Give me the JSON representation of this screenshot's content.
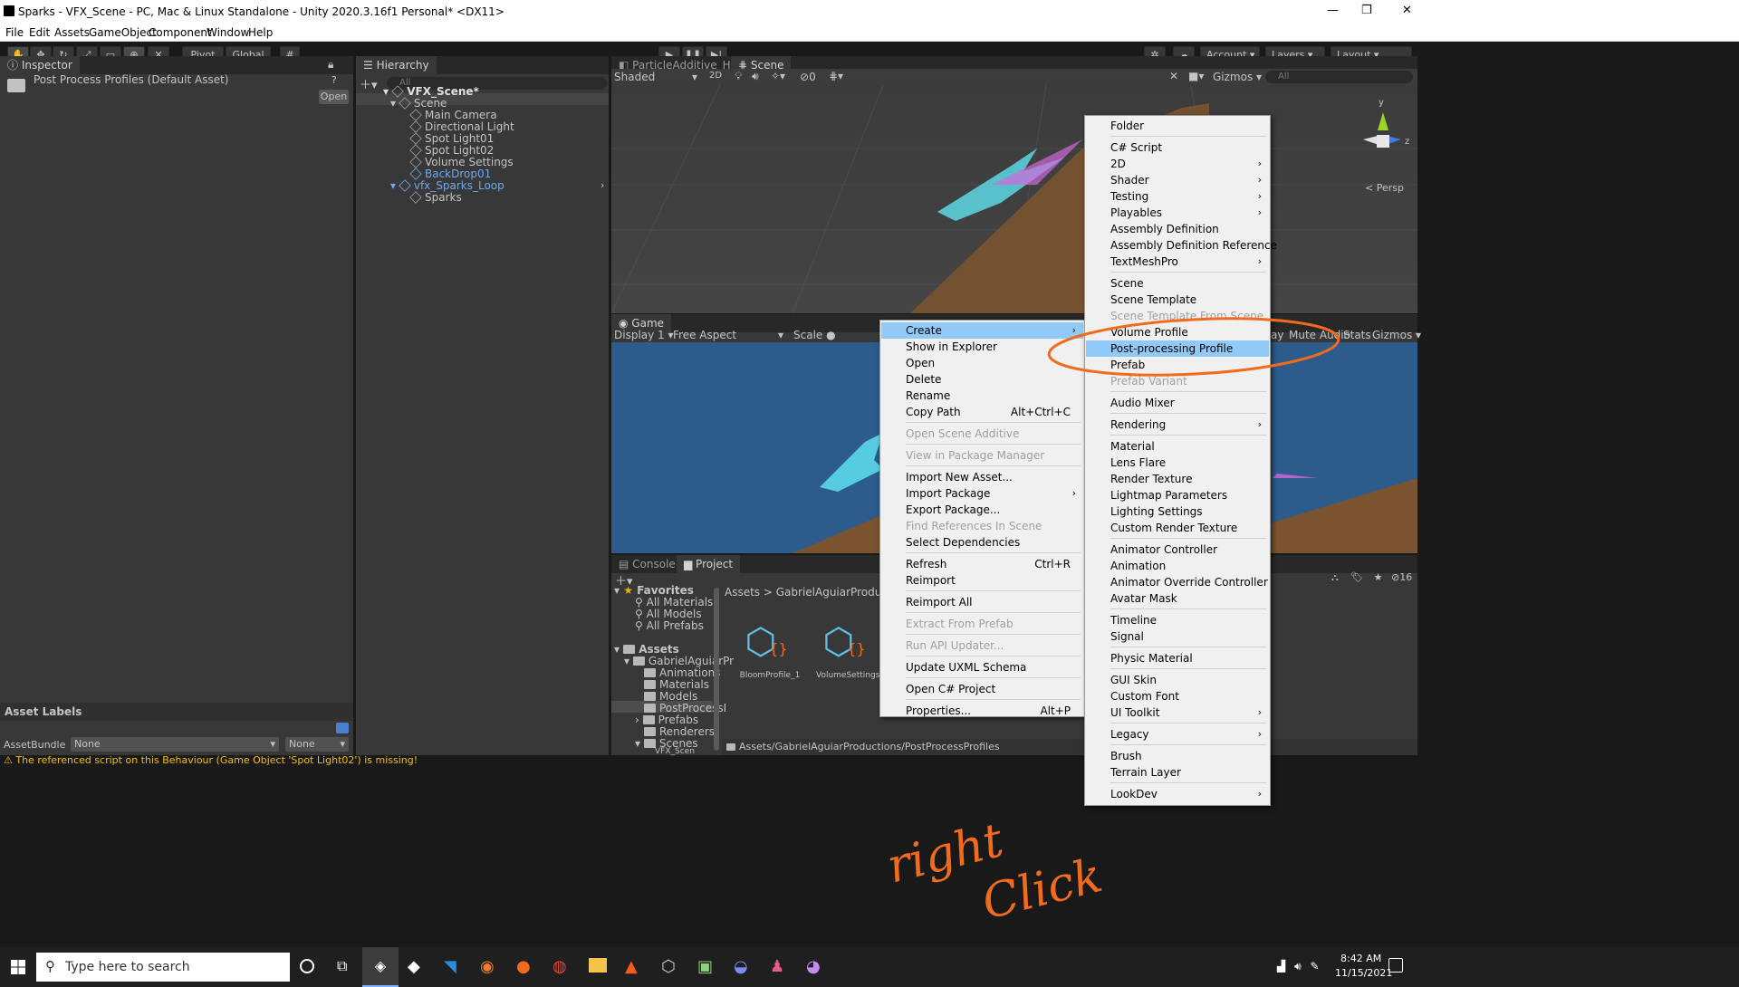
{
  "window": {
    "title": "Sparks - VFX_Scene - PC, Mac & Linux Standalone - Unity 2020.3.16f1 Personal* <DX11>",
    "min": "—",
    "max": "❐",
    "close": "✕"
  },
  "menubar": [
    "File",
    "Edit",
    "Assets",
    "GameObject",
    "Component",
    "Window",
    "Help"
  ],
  "toolbar": {
    "pivot": "Pivot",
    "global": "Global",
    "account": "Account",
    "layers": "Layers",
    "layout": "Layout"
  },
  "inspector": {
    "tab": "Inspector",
    "asset_title": "Post Process Profiles (Default Asset)",
    "open_button": "Open",
    "asset_labels": "Asset Labels",
    "asset_bundle_label": "AssetBundle",
    "bundle_value": "None",
    "variant_value": "None"
  },
  "hierarchy": {
    "tab": "Hierarchy",
    "search_placeholder": "All",
    "items": [
      {
        "label": "VFX_Scene*",
        "bold": true
      },
      {
        "label": "Scene"
      },
      {
        "label": "Main Camera"
      },
      {
        "label": "Directional Light"
      },
      {
        "label": "Spot Light01"
      },
      {
        "label": "Spot Light02"
      },
      {
        "label": "Volume Settings"
      },
      {
        "label": "BackDrop01",
        "blue": true
      },
      {
        "label": "vfx_Sparks_Loop",
        "blue": true
      },
      {
        "label": "Sparks"
      }
    ]
  },
  "scene_view": {
    "tab_particle": "ParticleAdditive_HDR",
    "tab_scene": "Scene",
    "shading": "Shaded",
    "mode_2d": "2D",
    "hidden_count": "0",
    "gizmos": "Gizmos",
    "search_placeholder": "All",
    "persp": "< Persp",
    "axis_y": "y",
    "axis_z": "z"
  },
  "game_view": {
    "tab": "Game",
    "display": "Display 1",
    "aspect": "Free Aspect",
    "scale": "Scale",
    "play": "ay",
    "mute": "Mute Audio",
    "stats": "Stats",
    "gizmos": "Gizmos"
  },
  "project": {
    "tab_console": "Console",
    "tab_project": "Project",
    "favorites_label": "Favorites",
    "favorites": [
      "All Materials",
      "All Models",
      "All Prefabs"
    ],
    "assets_label": "Assets",
    "tree": [
      "GabrielAguiarPr",
      "Animations",
      "Materials",
      "Models",
      "PostProcessI",
      "Prefabs",
      "Renderers",
      "Scenes",
      "VFX_Scen"
    ],
    "breadcrumb": [
      "Assets",
      "GabrielAguiarProductions"
    ],
    "files": [
      {
        "name": "BloomProfile_1"
      },
      {
        "name": "VolumeSettings"
      }
    ],
    "path": "Assets/GabrielAguiarProductions/PostProcessProfiles",
    "icon_count": "16"
  },
  "context_menu": [
    {
      "label": "Create",
      "arrow": true,
      "selected": true
    },
    {
      "label": "Show in Explorer"
    },
    {
      "label": "Open"
    },
    {
      "label": "Delete"
    },
    {
      "label": "Rename"
    },
    {
      "label": "Copy Path",
      "shortcut": "Alt+Ctrl+C"
    },
    {
      "sep": true
    },
    {
      "label": "Open Scene Additive",
      "disabled": true
    },
    {
      "sep": true
    },
    {
      "label": "View in Package Manager",
      "disabled": true
    },
    {
      "sep": true
    },
    {
      "label": "Import New Asset..."
    },
    {
      "label": "Import Package",
      "arrow": true
    },
    {
      "label": "Export Package..."
    },
    {
      "label": "Find References In Scene",
      "disabled": true
    },
    {
      "label": "Select Dependencies"
    },
    {
      "sep": true
    },
    {
      "label": "Refresh",
      "shortcut": "Ctrl+R"
    },
    {
      "label": "Reimport"
    },
    {
      "sep": true
    },
    {
      "label": "Reimport All"
    },
    {
      "sep": true
    },
    {
      "label": "Extract From Prefab",
      "disabled": true
    },
    {
      "sep": true
    },
    {
      "label": "Run API Updater...",
      "disabled": true
    },
    {
      "sep": true
    },
    {
      "label": "Update UXML Schema"
    },
    {
      "sep": true
    },
    {
      "label": "Open C# Project"
    },
    {
      "sep": true
    },
    {
      "label": "Properties...",
      "shortcut": "Alt+P"
    }
  ],
  "create_menu": [
    {
      "label": "Folder"
    },
    {
      "sep": true
    },
    {
      "label": "C# Script"
    },
    {
      "label": "2D",
      "arrow": true
    },
    {
      "label": "Shader",
      "arrow": true
    },
    {
      "label": "Testing",
      "arrow": true
    },
    {
      "label": "Playables",
      "arrow": true
    },
    {
      "label": "Assembly Definition"
    },
    {
      "label": "Assembly Definition Reference"
    },
    {
      "label": "TextMeshPro",
      "arrow": true
    },
    {
      "sep": true
    },
    {
      "label": "Scene"
    },
    {
      "label": "Scene Template"
    },
    {
      "label": "Scene Template From Scene",
      "disabled": true
    },
    {
      "label": "Volume Profile"
    },
    {
      "label": "Post-processing Profile",
      "selected": true
    },
    {
      "label": "Prefab"
    },
    {
      "label": "Prefab Variant",
      "disabled": true
    },
    {
      "sep": true
    },
    {
      "label": "Audio Mixer"
    },
    {
      "sep": true
    },
    {
      "label": "Rendering",
      "arrow": true
    },
    {
      "sep": true
    },
    {
      "label": "Material"
    },
    {
      "label": "Lens Flare"
    },
    {
      "label": "Render Texture"
    },
    {
      "label": "Lightmap Parameters"
    },
    {
      "label": "Lighting Settings"
    },
    {
      "label": "Custom Render Texture"
    },
    {
      "sep": true
    },
    {
      "label": "Animator Controller"
    },
    {
      "label": "Animation"
    },
    {
      "label": "Animator Override Controller"
    },
    {
      "label": "Avatar Mask"
    },
    {
      "sep": true
    },
    {
      "label": "Timeline"
    },
    {
      "label": "Signal"
    },
    {
      "sep": true
    },
    {
      "label": "Physic Material"
    },
    {
      "sep": true
    },
    {
      "label": "GUI Skin"
    },
    {
      "label": "Custom Font"
    },
    {
      "label": "UI Toolkit",
      "arrow": true
    },
    {
      "sep": true
    },
    {
      "label": "Legacy",
      "arrow": true
    },
    {
      "sep": true
    },
    {
      "label": "Brush"
    },
    {
      "label": "Terrain Layer"
    },
    {
      "sep": true
    },
    {
      "label": "LookDev",
      "arrow": true
    }
  ],
  "status": {
    "message": "The referenced script on this Behaviour (Game Object 'Spot Light02') is missing!"
  },
  "annotation": {
    "line1": "right",
    "line2": "Click"
  },
  "taskbar": {
    "search_placeholder": "Type here to search",
    "time": "8:42 AM",
    "date": "11/15/2021"
  },
  "colors": {
    "editor_bg": "#383838",
    "menu_bg": "#f0f0f0",
    "menu_highlight": "#91c9f7",
    "annotation": "#f26b1d",
    "scene_sky": "#2d5b8c",
    "floor": "#7a5330"
  }
}
